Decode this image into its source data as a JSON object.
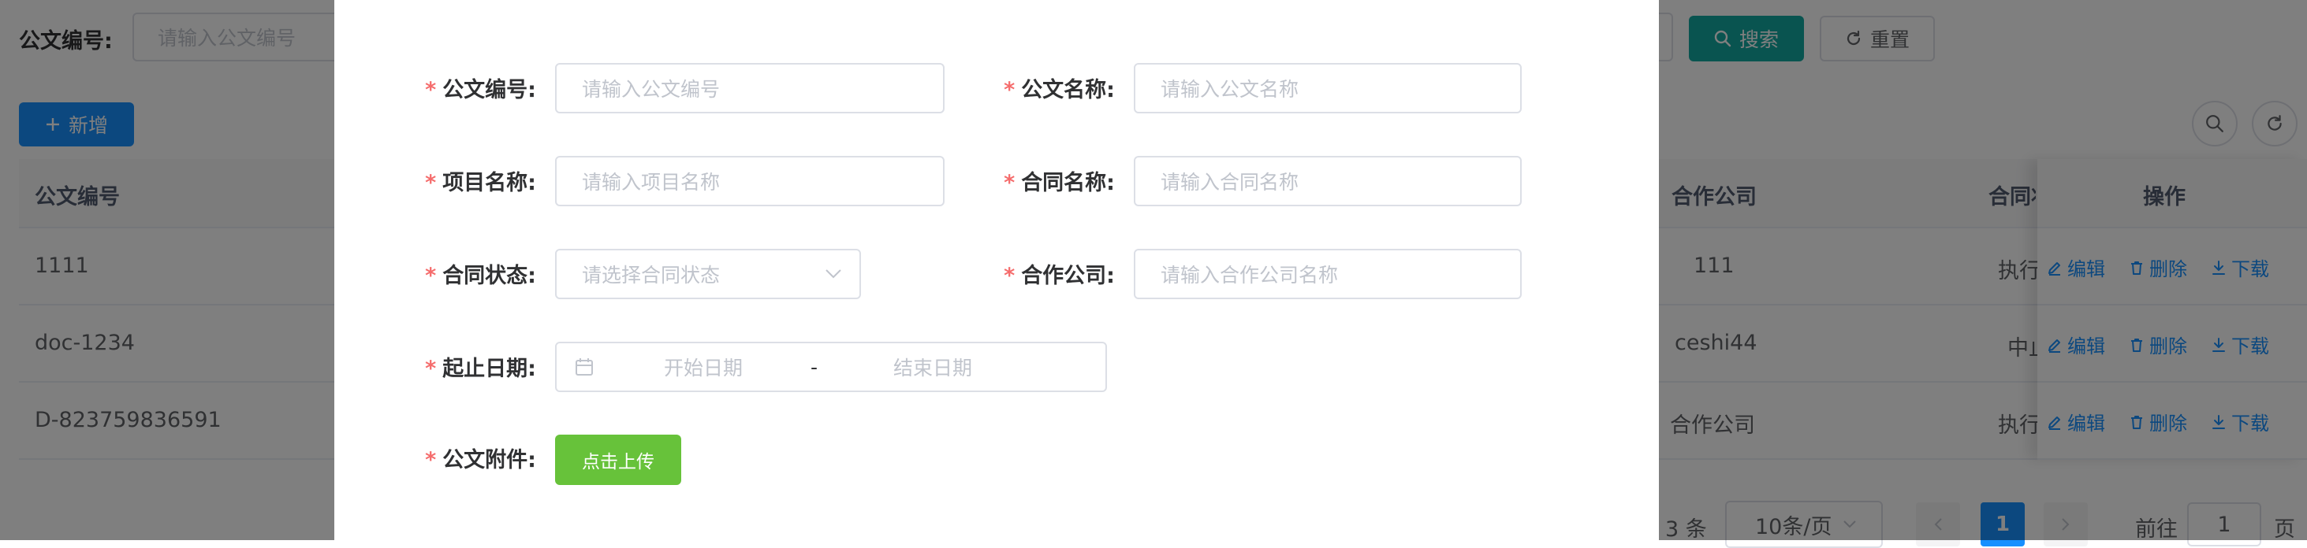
{
  "search_bar": {
    "doc_no_label": "公文编号:",
    "doc_no_placeholder": "请输入公文编号",
    "search_button": "搜索",
    "reset_button": "重置"
  },
  "toolbar": {
    "add_button": "新增"
  },
  "table": {
    "columns": {
      "doc_no": "公文编号",
      "partner": "合作公司",
      "status": "合同状",
      "actions": "操作"
    },
    "rows": [
      {
        "doc_no": "1111",
        "partner": "111",
        "status": "执行"
      },
      {
        "doc_no": "doc-1234",
        "partner": "ceshi44",
        "status": "中止"
      },
      {
        "doc_no": "D-823759836591",
        "partner": "合作公司",
        "status": "执行"
      }
    ],
    "actions": {
      "edit": "编辑",
      "delete": "删除",
      "download": "下载"
    }
  },
  "pagination": {
    "total": "3 条",
    "page_size": "10条/页",
    "current_page": "1",
    "goto_prefix": "前往",
    "goto_value": "1",
    "goto_suffix": "页"
  },
  "dialog": {
    "fields": {
      "doc_no": {
        "label": "公文编号:",
        "placeholder": "请输入公文编号"
      },
      "doc_name": {
        "label": "公文名称:",
        "placeholder": "请输入公文名称"
      },
      "project_name": {
        "label": "项目名称:",
        "placeholder": "请输入项目名称"
      },
      "contract_name": {
        "label": "合同名称:",
        "placeholder": "请输入合同名称"
      },
      "contract_status": {
        "label": "合同状态:",
        "placeholder": "请选择合同状态"
      },
      "partner": {
        "label": "合作公司:",
        "placeholder": "请输入合作公司名称"
      },
      "date_range": {
        "label": "起止日期:",
        "start_placeholder": "开始日期",
        "separator": "-",
        "end_placeholder": "结束日期"
      },
      "attachment": {
        "label": "公文附件:",
        "upload_button": "点击上传"
      }
    },
    "required_mark": "*"
  },
  "colors": {
    "primary": "#1890ff",
    "search": "#13a8a0",
    "upload": "#67c23a",
    "required": "#f56c6c",
    "mask": "rgba(0,0,0,0.5)"
  }
}
